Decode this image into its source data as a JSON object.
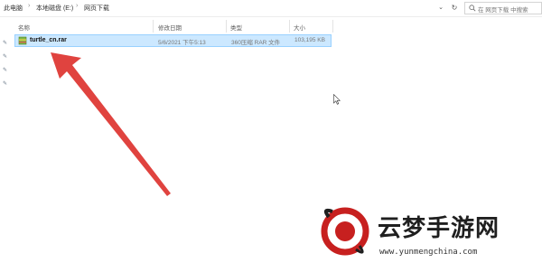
{
  "breadcrumb": {
    "items": [
      "此电脑",
      "本地磁盘 (E:)",
      "网页下载"
    ],
    "separator": "›"
  },
  "search": {
    "placeholder": "在 网页下载 中搜索"
  },
  "columns": {
    "name": "名称",
    "modified": "修改日期",
    "type": "类型",
    "size": "大小"
  },
  "files": [
    {
      "name": "turtle_cn.rar",
      "modified": "5/6/2021 下午5:13",
      "type": "360压缩 RAR 文件",
      "size": "103,195 KB",
      "selected": true
    }
  ],
  "colors": {
    "selection_bg": "#cce8ff",
    "selection_border": "#99d1ff",
    "arrow": "#e0433f"
  },
  "watermark": {
    "title": "云梦手游网",
    "url": "www.yunmengchina.com"
  }
}
